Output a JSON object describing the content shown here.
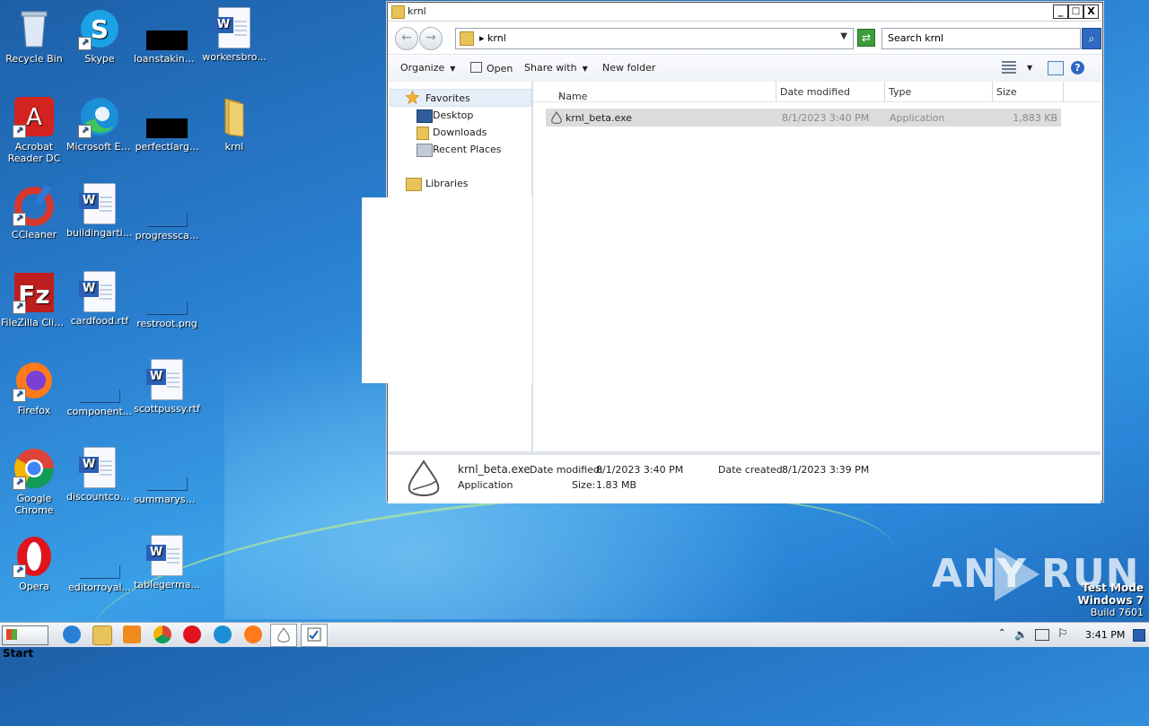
{
  "desktop": {
    "icons": [
      {
        "label": "Recycle Bin",
        "icon": "recycle-bin-icon"
      },
      {
        "label": "Skype",
        "icon": "skype-icon"
      },
      {
        "label": "loanstaking...",
        "icon": "black-thumbnail-icon"
      },
      {
        "label": "workersbro...",
        "icon": "word-doc-icon"
      },
      {
        "label": "Acrobat Reader DC",
        "icon": "acrobat-icon"
      },
      {
        "label": "Microsoft Edge",
        "icon": "edge-icon"
      },
      {
        "label": "perfectlarg...",
        "icon": "black-thumbnail-icon"
      },
      {
        "label": "krnl",
        "icon": "folder-icon"
      },
      {
        "label": "CCleaner",
        "icon": "ccleaner-icon"
      },
      {
        "label": "buildingartic...",
        "icon": "word-doc-icon"
      },
      {
        "label": "progressca...",
        "icon": "blank-file-icon"
      },
      {
        "label": "FileZilla Client",
        "icon": "filezilla-icon"
      },
      {
        "label": "cardfood.rtf",
        "icon": "word-doc-icon"
      },
      {
        "label": "restroot.png",
        "icon": "blank-file-icon"
      },
      {
        "label": "Firefox",
        "icon": "firefox-icon"
      },
      {
        "label": "component...",
        "icon": "blank-file-icon"
      },
      {
        "label": "scottpussy.rtf",
        "icon": "word-doc-icon"
      },
      {
        "label": "Google Chrome",
        "icon": "chrome-icon"
      },
      {
        "label": "discountcou...",
        "icon": "word-doc-icon"
      },
      {
        "label": "summaryshi...",
        "icon": "blank-file-icon"
      },
      {
        "label": "Opera",
        "icon": "opera-icon"
      },
      {
        "label": "editorroyal...",
        "icon": "blank-file-icon"
      },
      {
        "label": "tablegerma...",
        "icon": "word-doc-icon"
      }
    ]
  },
  "window": {
    "title": "krnl",
    "address_crumb": "krnl",
    "search_placeholder": "Search krnl",
    "controls": {
      "minimize": "_",
      "maximize": "□",
      "close": "X"
    },
    "toolbar": {
      "organize": "Organize",
      "open": "Open",
      "share_with": "Share with",
      "new_folder": "New folder"
    },
    "nav": {
      "favorites": "Favorites",
      "desktop": "Desktop",
      "downloads": "Downloads",
      "recent_places": "Recent Places",
      "libraries": "Libraries"
    },
    "columns": {
      "name": "Name",
      "date_modified": "Date modified",
      "type": "Type",
      "size": "Size"
    },
    "files": [
      {
        "name": "krnl_beta.exe",
        "date_modified": "8/1/2023 3:40 PM",
        "type": "Application",
        "size": "1,883 KB"
      }
    ],
    "details": {
      "name": "krnl_beta.exe",
      "type": "Application",
      "date_modified_label": "Date modified:",
      "date_modified": "8/1/2023 3:40 PM",
      "size_label": "Size:",
      "size": "1.83 MB",
      "date_created_label": "Date created:",
      "date_created": "8/1/2023 3:39 PM"
    }
  },
  "watermark": {
    "brand": "ANY RUN"
  },
  "os_badge": {
    "line1": "Test Mode",
    "line2": "Windows 7",
    "line3": "Build 7601"
  },
  "taskbar": {
    "start_label": "Start",
    "clock": "3:41 PM",
    "pinned": [
      "ie-icon",
      "explorer-icon",
      "media-player-icon",
      "chrome-icon",
      "opera-icon",
      "edge-icon",
      "firefox-icon",
      "krnl-icon",
      "anyrun-icon"
    ]
  }
}
